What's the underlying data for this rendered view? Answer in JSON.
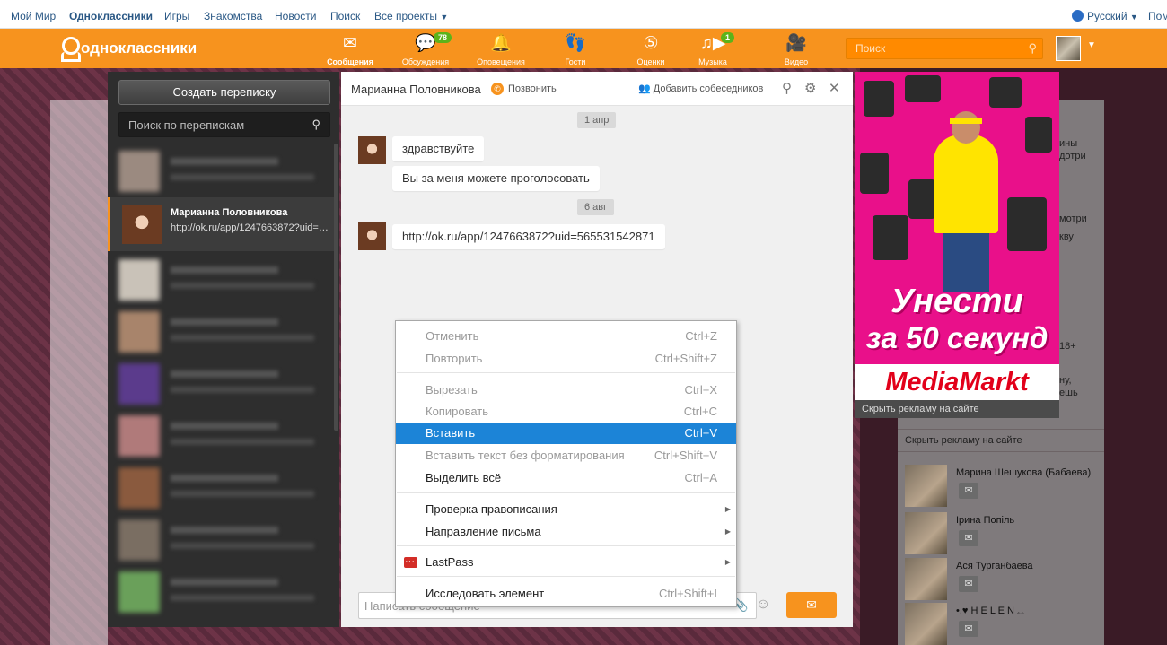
{
  "topbar": {
    "links": [
      "Мой Мир",
      "Одноклассники",
      "Игры",
      "Знакомства",
      "Новости",
      "Поиск",
      "Все проекты"
    ],
    "language": "Русский",
    "right_cut": "Пом"
  },
  "header": {
    "logo": "одноклассники",
    "nav": [
      {
        "label": "Сообщения",
        "icon": "envelope-icon",
        "badge": ""
      },
      {
        "label": "Обсуждения",
        "icon": "chat-bubbles-icon",
        "badge": "78"
      },
      {
        "label": "Оповещения",
        "icon": "bell-icon",
        "badge": ""
      },
      {
        "label": "Гости",
        "icon": "footprints-icon",
        "badge": ""
      },
      {
        "label": "Оценки",
        "icon": "rating-icon",
        "badge": ""
      },
      {
        "label": "Музыка",
        "icon": "music-note-icon",
        "badge": "1"
      },
      {
        "label": "Видео",
        "icon": "video-camera-icon",
        "badge": ""
      }
    ],
    "search_placeholder": "Поиск"
  },
  "sidebar": {
    "new_chat": "Создать переписку",
    "search_placeholder": "Поиск по перепискам",
    "selected": {
      "name": "Марианна Половникова",
      "preview": "http://ok.ru/app/1247663872?uid=565531542871"
    }
  },
  "chat": {
    "contact": "Марианна Половникова",
    "call": "Позвонить",
    "add": "Добавить собеседников",
    "messages": [
      {
        "date": "1 апр",
        "texts": [
          "здравствуйте",
          "Вы за меня можете проголосовать"
        ]
      },
      {
        "date": "6 авг",
        "texts": [
          "http://ok.ru/app/1247663872?uid=565531542871"
        ]
      }
    ],
    "composer_placeholder": "Написать сообщение"
  },
  "ad": {
    "headline1": "Унести",
    "headline2": "за 50 секунд",
    "brand": "MediaMarkt",
    "hide": "Скрыть рекламу на сайте"
  },
  "right": {
    "hide_ads": "Скрыть рекламу на сайте",
    "friends": [
      "Марина Шешукова (Бабаева)",
      "Ірина Попіль",
      "Ася Турганбаева",
      "•.♥ H E L E N ۦۦ"
    ],
    "partial": [
      "ины",
      "дотри",
      "мотри",
      "кву",
      "ну,",
      "ешь",
      "18+"
    ]
  },
  "context_menu": {
    "items": [
      {
        "label": "Отменить",
        "shortcut": "Ctrl+Z",
        "state": "disabled"
      },
      {
        "label": "Повторить",
        "shortcut": "Ctrl+Shift+Z",
        "state": "disabled"
      },
      {
        "label": "Вырезать",
        "shortcut": "Ctrl+X",
        "state": "disabled"
      },
      {
        "label": "Копировать",
        "shortcut": "Ctrl+C",
        "state": "disabled"
      },
      {
        "label": "Вставить",
        "shortcut": "Ctrl+V",
        "state": "highlighted"
      },
      {
        "label": "Вставить текст без форматирования",
        "shortcut": "Ctrl+Shift+V",
        "state": "disabled"
      },
      {
        "label": "Выделить всё",
        "shortcut": "Ctrl+A",
        "state": "enabled"
      },
      {
        "label": "Проверка правописания",
        "shortcut": "",
        "state": "submenu"
      },
      {
        "label": "Направление письма",
        "shortcut": "",
        "state": "submenu"
      },
      {
        "label": "LastPass",
        "shortcut": "",
        "state": "submenu"
      },
      {
        "label": "Исследовать элемент",
        "shortcut": "Ctrl+Shift+I",
        "state": "enabled"
      }
    ]
  },
  "colors": {
    "brand": "#f7931e",
    "highlight": "#1c84d7",
    "badge": "#5cb31a"
  }
}
